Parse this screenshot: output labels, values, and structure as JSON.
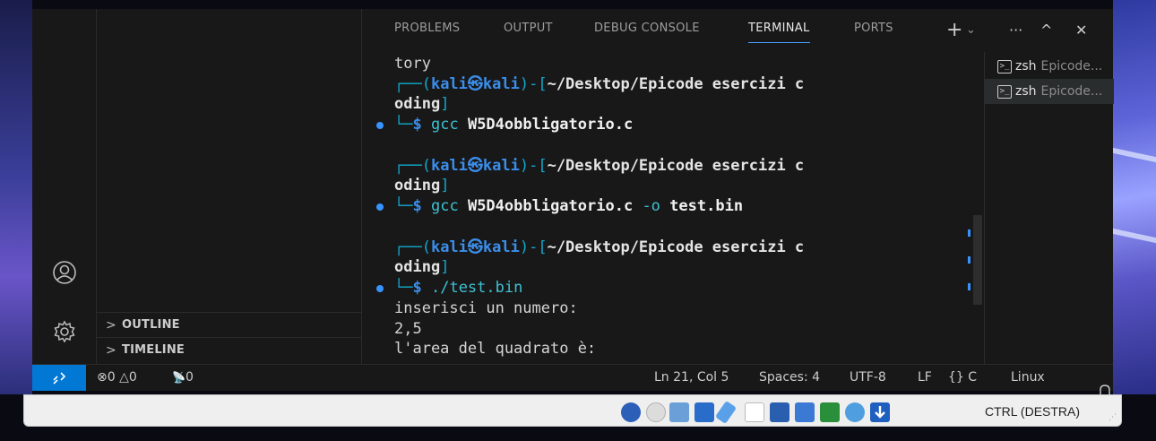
{
  "panel": {
    "tabs": [
      "PROBLEMS",
      "OUTPUT",
      "DEBUG CONSOLE",
      "TERMINAL",
      "PORTS"
    ],
    "active_tab": "TERMINAL",
    "actions": {
      "new": "+",
      "dropdown": "⌄",
      "more": "···",
      "maximize": "^",
      "close": "✕"
    }
  },
  "sidebar": {
    "sections": [
      {
        "chevron": ">",
        "label": "OUTLINE"
      },
      {
        "chevron": ">",
        "label": "TIMELINE"
      }
    ]
  },
  "terminal": {
    "lines": [
      {
        "type": "text",
        "text": "tory"
      },
      {
        "type": "prompt",
        "user": "kali",
        "at": "㉿",
        "host": "kali",
        "path": "~/Desktop/Epicode esercizi c",
        "path_cont": "oding"
      },
      {
        "type": "command",
        "cmd": "gcc",
        "args": "W5D4obbligatorio.c",
        "flag": "",
        "out": ""
      },
      {
        "type": "prompt",
        "user": "kali",
        "at": "㉿",
        "host": "kali",
        "path": "~/Desktop/Epicode esercizi c",
        "path_cont": "oding"
      },
      {
        "type": "command",
        "cmd": "gcc",
        "args": "W5D4obbligatorio.c",
        "flag": "-o",
        "out": "test.bin"
      },
      {
        "type": "prompt",
        "user": "kali",
        "at": "㉿",
        "host": "kali",
        "path": "~/Desktop/Epicode esercizi c",
        "path_cont": "oding"
      },
      {
        "type": "command",
        "cmd": "./test.bin",
        "args": "",
        "flag": "",
        "out": ""
      },
      {
        "type": "text",
        "text": "inserisci un numero:"
      },
      {
        "type": "text",
        "text": "2,5"
      },
      {
        "type": "text",
        "text": "l'area del quadrato è:"
      }
    ],
    "dollar": "$"
  },
  "terminal_list": [
    {
      "name": "zsh",
      "desc": "Epicode...",
      "selected": false
    },
    {
      "name": "zsh",
      "desc": "Epicode...",
      "selected": true
    }
  ],
  "statusbar": {
    "remote_icon": "remote-icon",
    "errors": "0",
    "warnings": "0",
    "ports": "0",
    "position": "Ln 21, Col 5",
    "spaces": "Spaces: 4",
    "encoding": "UTF-8",
    "eol": "LF",
    "language": "{} C",
    "platform": "Linux"
  },
  "vbox": {
    "host_key": "CTRL (DESTRA)"
  },
  "colors": {
    "accent": "#0078d4",
    "tab_underline": "#4d9cff",
    "prompt_blue": "#3b8eea",
    "command_cyan": "#3ec1d3"
  }
}
